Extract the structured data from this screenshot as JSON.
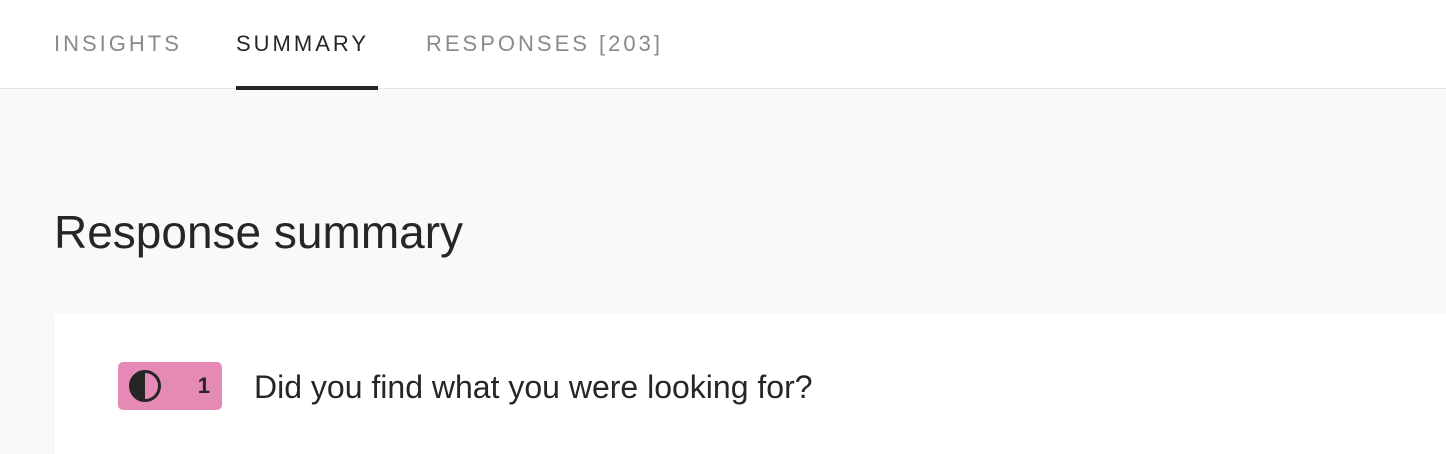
{
  "tabs": [
    {
      "label": "INSIGHTS",
      "active": false
    },
    {
      "label": "SUMMARY",
      "active": true
    },
    {
      "label": "RESPONSES [203]",
      "active": false
    }
  ],
  "main": {
    "title": "Response summary"
  },
  "question": {
    "number": "1",
    "text": "Did you find what you were looking for?",
    "icon": "half-circle-icon",
    "badge_color": "#e48ab5"
  }
}
